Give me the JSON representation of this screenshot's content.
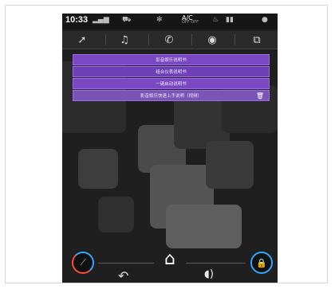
{
  "status": {
    "time": "10:33",
    "ac_label": "A/C",
    "ac_sub": "OFF OFF"
  },
  "nav": {
    "items": [
      {
        "name": "navigation",
        "icon": "navigation-arrow-icon",
        "glyph": "➚"
      },
      {
        "name": "music",
        "icon": "music-note-icon",
        "glyph": "♫"
      },
      {
        "name": "phone",
        "icon": "phone-icon",
        "glyph": "✆"
      },
      {
        "name": "radio",
        "icon": "radio-antenna-icon",
        "glyph": "◉"
      },
      {
        "name": "apps",
        "icon": "folder-icon",
        "glyph": "⧉"
      }
    ]
  },
  "menu": {
    "items": [
      {
        "label": "影音娱乐说明书"
      },
      {
        "label": "组合仪表说明书"
      },
      {
        "label": "一键启动说明书"
      },
      {
        "label": "影音娱乐快速上手说明（视频）"
      }
    ],
    "accent_color": "#7a48c2"
  },
  "bottom": {
    "home_glyph": "⌂",
    "back_glyph": "↶",
    "volume_glyph": "◖)",
    "left_gauge_color": "#ff4b3e",
    "right_gauge_color": "#2fa6ff"
  }
}
